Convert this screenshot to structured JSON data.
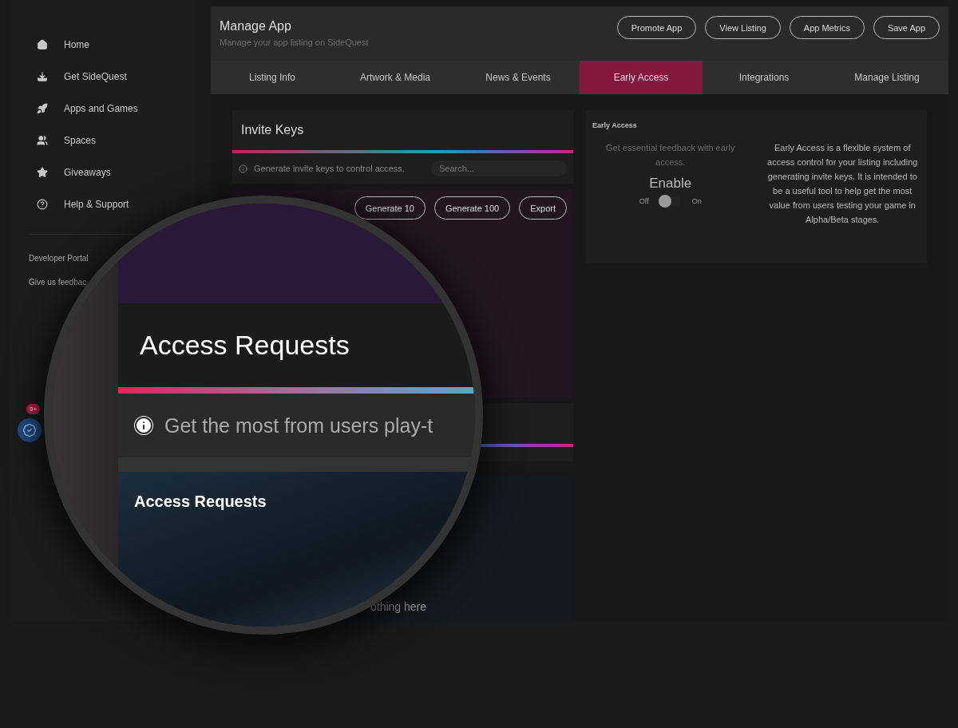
{
  "sidebar": {
    "nav": [
      {
        "label": "Home"
      },
      {
        "label": "Get SideQuest"
      },
      {
        "label": "Apps and Games"
      },
      {
        "label": "Spaces"
      },
      {
        "label": "Giveaways"
      },
      {
        "label": "Help & Support"
      }
    ],
    "links": [
      "Developer Portal",
      "Give us feedbac"
    ],
    "badge": "9+"
  },
  "header": {
    "title": "Manage App",
    "subtitle": "Manage your app listing on SideQuest",
    "buttons": [
      "Promote App",
      "View Listing",
      "App Metrics",
      "Save App"
    ]
  },
  "tabs": [
    {
      "label": "Listing Info",
      "selected": false
    },
    {
      "label": "Artwork & Media",
      "selected": false
    },
    {
      "label": "News & Events",
      "selected": false
    },
    {
      "label": "Early Access",
      "selected": true
    },
    {
      "label": "Integrations",
      "selected": false
    },
    {
      "label": "Manage Listing",
      "selected": false
    }
  ],
  "invite_keys": {
    "title": "Invite Keys",
    "info": "Generate invite keys to control access.",
    "search_placeholder": "Search...",
    "buttons": [
      "Generate 10",
      "Generate 100",
      "Export"
    ]
  },
  "early_access": {
    "title": "Early Access",
    "tagline": "Get essential feedback with early access.",
    "enable_label": "Enable",
    "toggle": {
      "off_label": "Off",
      "on_label": "On",
      "on": false
    },
    "description": "Early Access is a flexible system of access control for your listing including generating invite keys. It is intended to be a useful tool to help get the most value from users testing your game in Alpha/Beta stages."
  },
  "empty_text": "othing here",
  "magnifier": {
    "title": "Access Requests",
    "info": "Get the most from users play-t",
    "section_title": "Access Requests"
  }
}
